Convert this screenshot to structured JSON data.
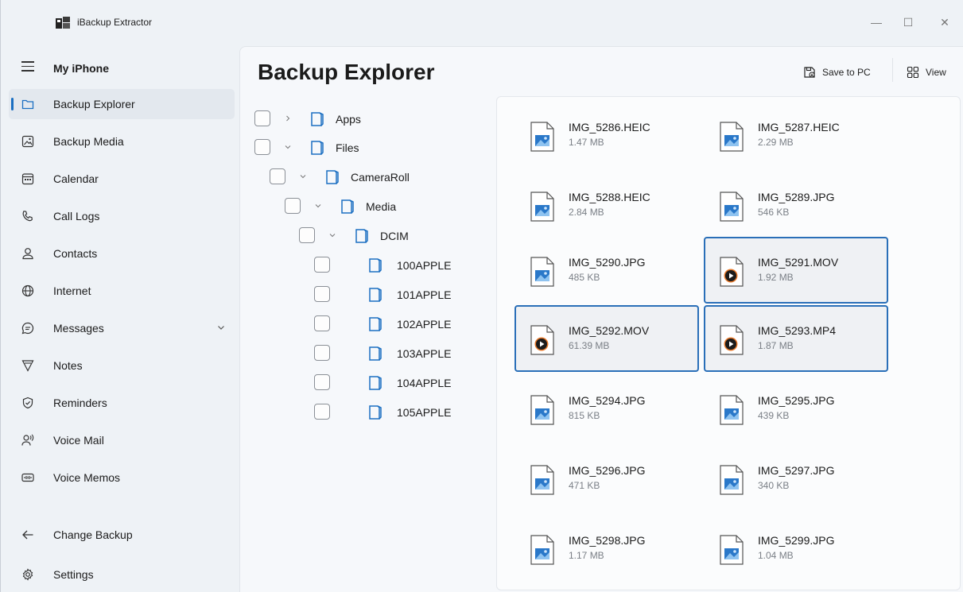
{
  "window": {
    "title": "iBackup Extractor",
    "minimize_glyph": "—",
    "maximize_glyph": "☐",
    "close_glyph": "✕"
  },
  "sidebar": {
    "top_label": "My iPhone",
    "items": [
      {
        "label": "Backup Explorer",
        "icon": "folder-icon",
        "active": true
      },
      {
        "label": "Backup Media",
        "icon": "image-icon"
      },
      {
        "label": "Calendar",
        "icon": "calendar-icon"
      },
      {
        "label": "Call Logs",
        "icon": "phone-icon"
      },
      {
        "label": "Contacts",
        "icon": "person-icon"
      },
      {
        "label": "Internet",
        "icon": "globe-icon"
      },
      {
        "label": "Messages",
        "icon": "chat-icon",
        "expandable": true
      },
      {
        "label": "Notes",
        "icon": "notes-icon"
      },
      {
        "label": "Reminders",
        "icon": "reminder-icon"
      },
      {
        "label": "Voice Mail",
        "icon": "voicemail-icon"
      },
      {
        "label": "Voice Memos",
        "icon": "voice-memo-icon"
      }
    ],
    "change_backup": "Change Backup",
    "settings": "Settings"
  },
  "main": {
    "title": "Backup Explorer",
    "save_label": "Save to PC",
    "view_label": "View"
  },
  "tree": [
    {
      "label": "Apps",
      "chevron": "right"
    },
    {
      "label": "Files",
      "chevron": "down"
    },
    {
      "label": "CameraRoll",
      "chevron": "down"
    },
    {
      "label": "Media",
      "chevron": "down"
    },
    {
      "label": "DCIM",
      "chevron": "down"
    },
    {
      "label": "100APPLE"
    },
    {
      "label": "101APPLE"
    },
    {
      "label": "102APPLE"
    },
    {
      "label": "103APPLE"
    },
    {
      "label": "104APPLE"
    },
    {
      "label": "105APPLE"
    }
  ],
  "files": [
    {
      "name": "IMG_5286.HEIC",
      "size": "1.47 MB",
      "kind": "image"
    },
    {
      "name": "IMG_5287.HEIC",
      "size": "2.29 MB",
      "kind": "image"
    },
    {
      "name": "IMG_5288.HEIC",
      "size": "2.84 MB",
      "kind": "image"
    },
    {
      "name": "IMG_5289.JPG",
      "size": "546 KB",
      "kind": "image"
    },
    {
      "name": "IMG_5290.JPG",
      "size": "485 KB",
      "kind": "image"
    },
    {
      "name": "IMG_5291.MOV",
      "size": "1.92 MB",
      "kind": "video",
      "selected": true
    },
    {
      "name": "IMG_5292.MOV",
      "size": "61.39 MB",
      "kind": "video",
      "selected": true
    },
    {
      "name": "IMG_5293.MP4",
      "size": "1.87 MB",
      "kind": "video",
      "selected": true
    },
    {
      "name": "IMG_5294.JPG",
      "size": "815 KB",
      "kind": "image"
    },
    {
      "name": "IMG_5295.JPG",
      "size": "439 KB",
      "kind": "image"
    },
    {
      "name": "IMG_5296.JPG",
      "size": "471 KB",
      "kind": "image"
    },
    {
      "name": "IMG_5297.JPG",
      "size": "340 KB",
      "kind": "image"
    },
    {
      "name": "IMG_5298.JPG",
      "size": "1.17 MB",
      "kind": "image"
    },
    {
      "name": "IMG_5299.JPG",
      "size": "1.04 MB",
      "kind": "image"
    }
  ],
  "colors": {
    "accent": "#1b6fc2",
    "selection_border": "#2a6fb8",
    "image_icon": "#2a78c9"
  }
}
